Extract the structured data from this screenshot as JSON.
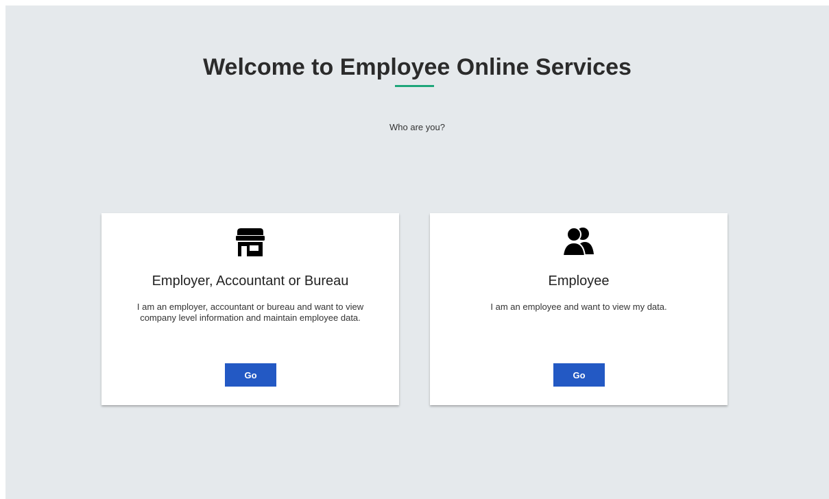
{
  "header": {
    "title": "Welcome to Employee Online Services",
    "subtitle": "Who are you?",
    "accent_color": "#1ea67a"
  },
  "cards": [
    {
      "icon": "store-icon",
      "title": "Employer, Accountant or Bureau",
      "description": "I am an employer, accountant or bureau and want to view company level information and maintain employee data.",
      "button_label": "Go"
    },
    {
      "icon": "users-icon",
      "title": "Employee",
      "description": "I am an employee and want to view my data.",
      "button_label": "Go"
    }
  ],
  "colors": {
    "background": "#e5e9ec",
    "button": "#2359c4"
  }
}
